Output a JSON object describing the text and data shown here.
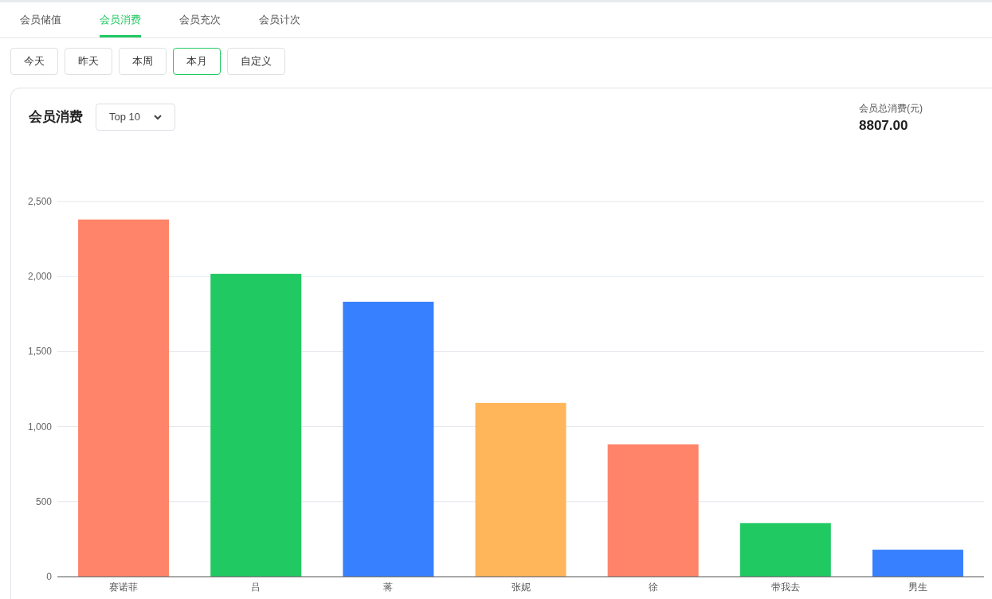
{
  "tabs": [
    {
      "label": "会员储值",
      "selected": false
    },
    {
      "label": "会员消费",
      "selected": true
    },
    {
      "label": "会员充次",
      "selected": false
    },
    {
      "label": "会员计次",
      "selected": false
    }
  ],
  "date_buttons": [
    {
      "label": "今天",
      "selected": false
    },
    {
      "label": "昨天",
      "selected": false
    },
    {
      "label": "本周",
      "selected": false
    },
    {
      "label": "本月",
      "selected": true
    },
    {
      "label": "自定义",
      "selected": false
    }
  ],
  "card": {
    "title": "会员消费",
    "top_select": {
      "value": "Top 10"
    },
    "total": {
      "label": "会员总消费(元)",
      "value": "8807.00"
    },
    "chart_data": {
      "type": "bar",
      "categories": [
        "赛诺菲",
        "吕",
        "蒋",
        "张妮",
        "徐",
        "带我去",
        "男生"
      ],
      "values": [
        2380,
        2018,
        1832,
        1158,
        882,
        357,
        180
      ],
      "colors": [
        "#ff8469",
        "#21c962",
        "#3780ff",
        "#ffb65a",
        "#ff8469",
        "#21c962",
        "#3780ff"
      ],
      "ylim": [
        0,
        2500
      ],
      "grid": true,
      "yticks": [
        {
          "value": 0,
          "label": "0"
        },
        {
          "value": 500,
          "label": "500"
        },
        {
          "value": 1000,
          "label": "1,000"
        },
        {
          "value": 1500,
          "label": "1,500"
        },
        {
          "value": 2000,
          "label": "2,000"
        },
        {
          "value": 2500,
          "label": "2,500"
        }
      ]
    }
  }
}
